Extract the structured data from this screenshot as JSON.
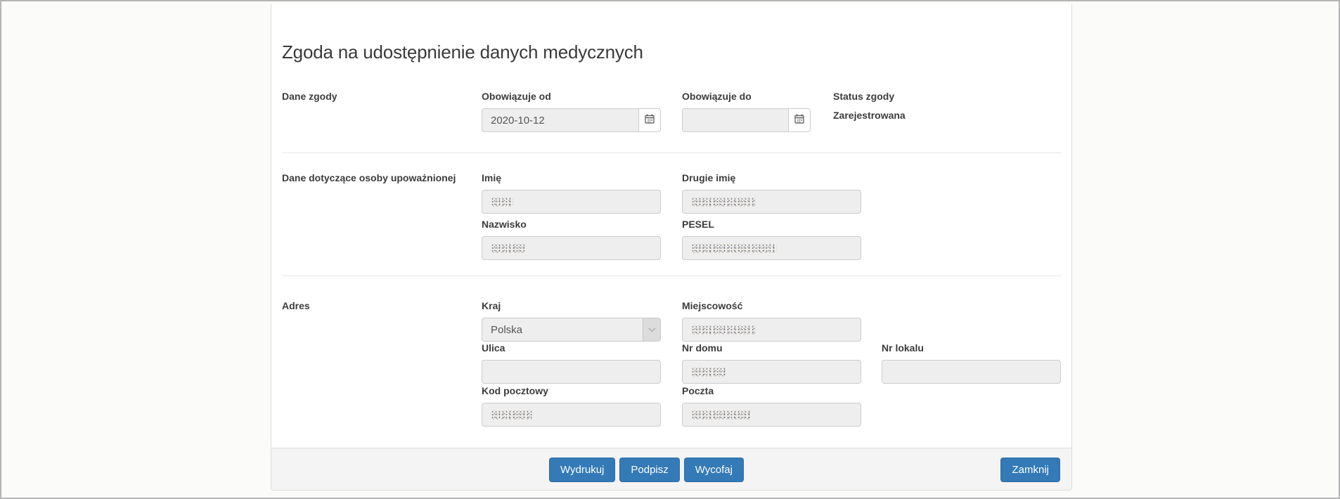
{
  "page": {
    "title": "Zgoda na udostępnienie danych medycznych"
  },
  "sections": {
    "consent": {
      "label": "Dane zgody",
      "valid_from": {
        "label": "Obowiązuje od",
        "value": "2020-10-12"
      },
      "valid_to": {
        "label": "Obowiązuje do",
        "value": ""
      },
      "status": {
        "label": "Status zgody",
        "value": "Zarejestrowana"
      }
    },
    "person": {
      "label": "Dane dotyczące osoby upoważnionej",
      "first_name": {
        "label": "Imię",
        "redacted": true
      },
      "middle_name": {
        "label": "Drugie imię",
        "redacted": true
      },
      "last_name": {
        "label": "Nazwisko",
        "redacted": true
      },
      "pesel": {
        "label": "PESEL",
        "redacted": true
      }
    },
    "address": {
      "label": "Adres",
      "country": {
        "label": "Kraj",
        "value": "Polska"
      },
      "city": {
        "label": "Miejscowość",
        "redacted": true
      },
      "street": {
        "label": "Ulica",
        "value": ""
      },
      "house_no": {
        "label": "Nr domu",
        "redacted": true
      },
      "apartment_no": {
        "label": "Nr lokalu",
        "value": ""
      },
      "postal_code": {
        "label": "Kod pocztowy",
        "redacted": true
      },
      "post_office": {
        "label": "Poczta",
        "redacted": true
      }
    }
  },
  "footer": {
    "print_label": "Wydrukuj",
    "sign_label": "Podpisz",
    "withdraw_label": "Wycofaj",
    "close_label": "Zamknij"
  },
  "icons": {
    "valid_from_addon": "calendar-icon",
    "valid_to_addon": "calendar-icon",
    "country_dropdown": "chevron-down-icon"
  },
  "colors": {
    "accent": "#337ab7",
    "accent_border": "#2e6da4",
    "input_bg": "#eeeeee",
    "footer_bg": "#f4f4f4",
    "card_bg": "#ffffff",
    "page_bg": "#fbfbf9"
  }
}
